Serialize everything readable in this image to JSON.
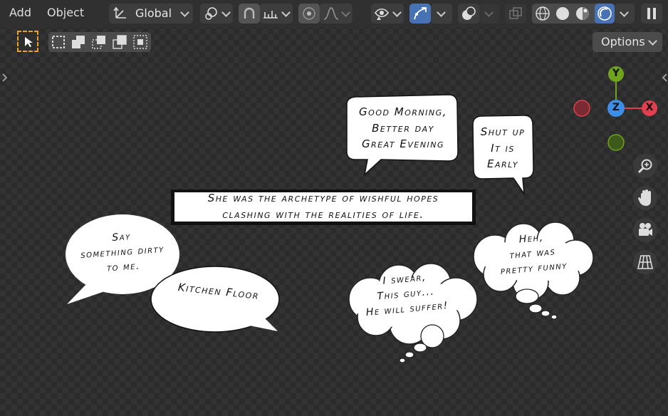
{
  "header": {
    "menu_add": "Add",
    "menu_object": "Object",
    "transform_orientation": "Global",
    "options_label": "Options"
  },
  "canvas": {
    "caption": [
      "She was the archetype of wishful hopes",
      "clashing with the realities of life."
    ],
    "bubble_morning": [
      "Good Morning,",
      "Better day",
      "Great Evening"
    ],
    "bubble_shut": [
      "Shut up",
      "It is",
      "Early"
    ],
    "bubble_say": [
      "Say",
      "something dirty",
      "to me."
    ],
    "bubble_kitchen": [
      "Kitchen Floor"
    ],
    "thought_swear": [
      "I swear,",
      "This guy...",
      "He will suffer!"
    ],
    "thought_heh": [
      "Heh,",
      "that was",
      "pretty funny"
    ]
  },
  "gizmo": {
    "y": "Y",
    "z": "Z",
    "x": "X"
  },
  "colors": {
    "accent": "#4772b3",
    "axis_x": "#e0404e",
    "axis_y": "#6fa21d",
    "axis_z": "#3d8ee6",
    "select_dashed": "#e8a030"
  },
  "icons": [
    "select-box-icon",
    "transform-orientation-icon",
    "snap-icon",
    "proportional-edit-icon",
    "visibility-icon",
    "gizmo-icon",
    "overlay-icon",
    "xray-icon",
    "wireframe-icon",
    "solid-icon",
    "material-icon",
    "rendered-icon",
    "zoom-icon",
    "hand-icon",
    "camera-icon",
    "grid-icon"
  ]
}
